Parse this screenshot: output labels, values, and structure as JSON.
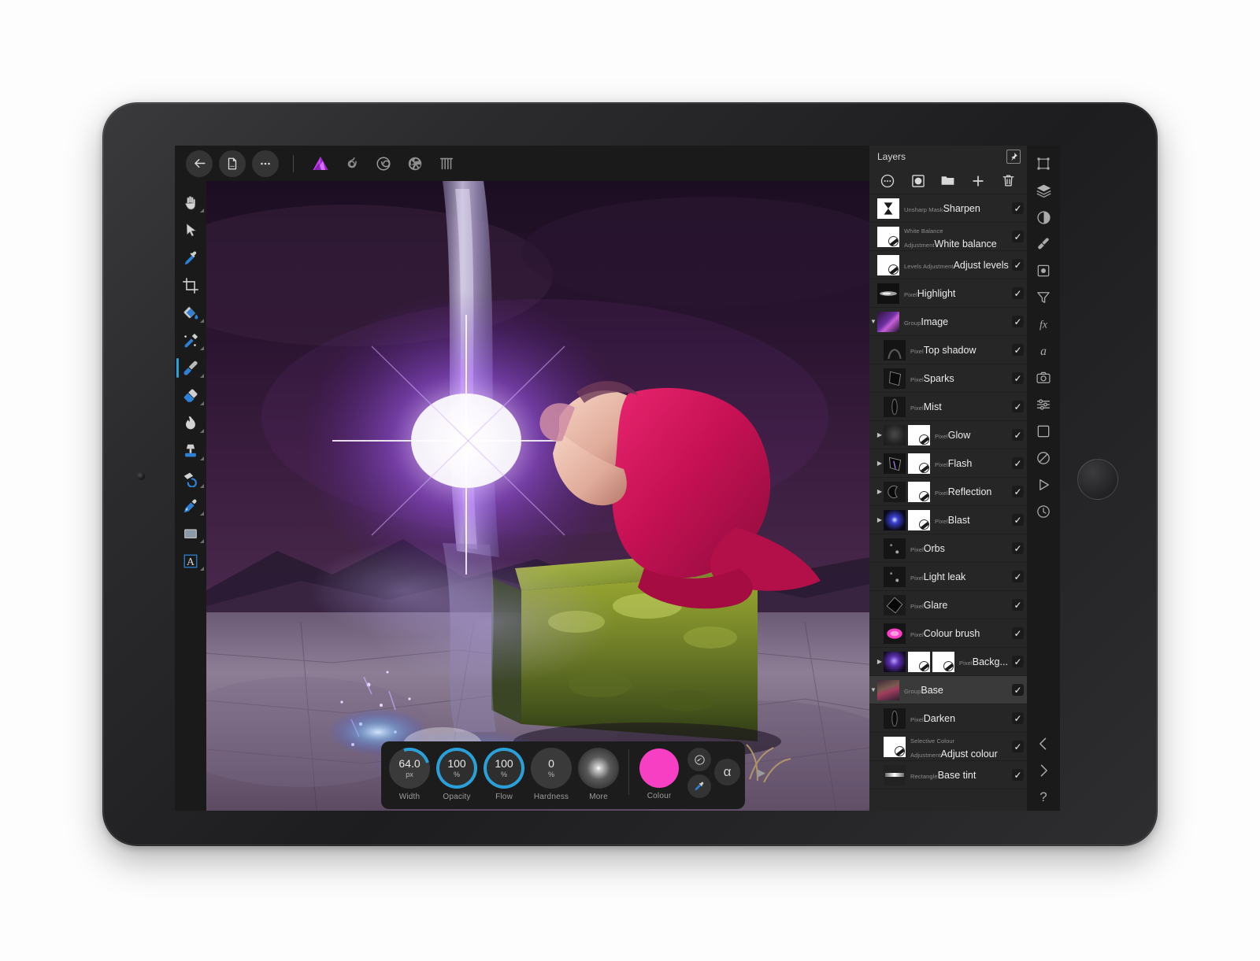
{
  "app": {
    "name": "Affinity Photo"
  },
  "topbar": {
    "buttons": [
      {
        "name": "back-button",
        "icon": "arrow-left-icon",
        "label": "Back"
      },
      {
        "name": "document-button",
        "icon": "document-icon",
        "label": "Document"
      },
      {
        "name": "more-button",
        "icon": "ellipsis-icon",
        "label": "More"
      }
    ],
    "personas": [
      {
        "name": "photo-persona",
        "icon": "affinity-photo-logo-icon",
        "label": "Photo Persona",
        "active": true,
        "color": "#c23ff0"
      },
      {
        "name": "liquify-persona",
        "icon": "liquify-icon",
        "label": "Liquify Persona",
        "active": false
      },
      {
        "name": "develop-persona",
        "icon": "develop-spiral-icon",
        "label": "Develop Persona",
        "active": false
      },
      {
        "name": "tone-mapping-persona",
        "icon": "shutter-icon",
        "label": "Tone Mapping Persona",
        "active": false
      },
      {
        "name": "export-persona",
        "icon": "export-slices-icon",
        "label": "Export Persona",
        "active": false
      }
    ]
  },
  "tools": [
    {
      "name": "hand-tool",
      "icon": "hand-icon",
      "label": "Hand",
      "selected": false,
      "submenu": true
    },
    {
      "name": "move-tool",
      "icon": "cursor-arrow-icon",
      "label": "Move",
      "selected": false,
      "submenu": false
    },
    {
      "name": "colour-picker-tool",
      "icon": "eyedropper-icon",
      "label": "Colour Picker",
      "selected": false,
      "submenu": false
    },
    {
      "name": "crop-tool",
      "icon": "crop-icon",
      "label": "Crop",
      "selected": false,
      "submenu": false
    },
    {
      "name": "flood-fill-tool",
      "icon": "paint-bucket-icon",
      "label": "Flood Fill",
      "selected": false,
      "submenu": true
    },
    {
      "name": "selection-brush-tool",
      "icon": "selection-brush-icon",
      "label": "Selection Brush",
      "selected": false,
      "submenu": true
    },
    {
      "name": "paint-brush-tool",
      "icon": "paint-brush-icon",
      "label": "Paint Brush",
      "selected": true,
      "submenu": true
    },
    {
      "name": "eraser-tool",
      "icon": "eraser-icon",
      "label": "Erase Brush",
      "selected": false,
      "submenu": true
    },
    {
      "name": "smudge-tool",
      "icon": "smudge-flame-icon",
      "label": "Smudge Brush",
      "selected": false,
      "submenu": true
    },
    {
      "name": "clone-tool",
      "icon": "clone-stamp-icon",
      "label": "Clone Brush",
      "selected": false,
      "submenu": true
    },
    {
      "name": "undo-brush-tool",
      "icon": "undo-brush-icon",
      "label": "Undo Brush",
      "selected": false,
      "submenu": true
    },
    {
      "name": "pen-tool",
      "icon": "pen-icon",
      "label": "Pen",
      "selected": false,
      "submenu": true
    },
    {
      "name": "shape-tool",
      "icon": "rectangle-shape-icon",
      "label": "Rectangle",
      "selected": false,
      "submenu": true
    },
    {
      "name": "text-tool",
      "icon": "text-a-icon",
      "label": "Artistic Text",
      "selected": false,
      "submenu": true
    }
  ],
  "brush_hud": {
    "items": [
      {
        "name": "width-dial",
        "label": "Width",
        "value": "64.0",
        "unit": "px",
        "ring": false,
        "arc": true
      },
      {
        "name": "opacity-dial",
        "label": "Opacity",
        "value": "100",
        "unit": "%",
        "ring": true,
        "arc": false
      },
      {
        "name": "flow-dial",
        "label": "Flow",
        "value": "100",
        "unit": "%",
        "ring": true,
        "arc": false
      },
      {
        "name": "hardness-dial",
        "label": "Hardness",
        "value": "0",
        "unit": "%",
        "ring": false,
        "arc": false
      },
      {
        "name": "more-dial",
        "label": "More",
        "value": "",
        "unit": "",
        "ring": false,
        "arc": false
      }
    ],
    "colour": {
      "label": "Colour",
      "hex": "#f73fc4"
    },
    "extras": [
      {
        "name": "brush-settings-button",
        "icon": "brush-edit-icon"
      },
      {
        "name": "colour-picker-button",
        "icon": "dropper-icon"
      },
      {
        "name": "alpha-button",
        "icon": "alpha-icon",
        "glyph": "α"
      }
    ],
    "expand": {
      "name": "expand-hud-button",
      "icon": "chevron-right-icon",
      "glyph": "▶"
    }
  },
  "layers_panel": {
    "title": "Layers",
    "pin": {
      "name": "pin-panel-button",
      "icon": "pin-icon"
    },
    "tools": [
      {
        "name": "layer-options-button",
        "icon": "ellipsis-circle-icon"
      },
      {
        "name": "add-mask-button",
        "icon": "mask-icon"
      },
      {
        "name": "add-group-button",
        "icon": "folder-icon"
      },
      {
        "name": "add-layer-button",
        "icon": "plus-icon"
      },
      {
        "name": "delete-layer-button",
        "icon": "trash-icon"
      }
    ],
    "rows": [
      {
        "kind": "Unsharp Mask",
        "name": "Sharpen",
        "indent": 0,
        "disclosure": "",
        "checked": true,
        "selected": false,
        "thumbs": [
          "white-hourglass"
        ]
      },
      {
        "kind": "White Balance Adjustment",
        "name": "White balance",
        "indent": 0,
        "disclosure": "",
        "checked": true,
        "selected": false,
        "thumbs": [
          "white-adj"
        ]
      },
      {
        "kind": "Levels Adjustment",
        "name": "Adjust levels",
        "indent": 0,
        "disclosure": "",
        "checked": true,
        "selected": false,
        "thumbs": [
          "white-adj"
        ]
      },
      {
        "kind": "Pixel",
        "name": "Highlight",
        "indent": 0,
        "disclosure": "",
        "checked": true,
        "selected": false,
        "thumbs": [
          "streak"
        ]
      },
      {
        "kind": "Group",
        "name": "Image",
        "indent": 0,
        "disclosure": "down",
        "checked": true,
        "selected": false,
        "thumbs": [
          "photo-blast"
        ]
      },
      {
        "kind": "Pixel",
        "name": "Top shadow",
        "indent": 1,
        "disclosure": "",
        "checked": true,
        "selected": false,
        "thumbs": [
          "dark-arch"
        ]
      },
      {
        "kind": "Pixel",
        "name": "Sparks",
        "indent": 1,
        "disclosure": "",
        "checked": true,
        "selected": false,
        "thumbs": [
          "dark-blob"
        ]
      },
      {
        "kind": "Pixel",
        "name": "Mist",
        "indent": 1,
        "disclosure": "",
        "checked": true,
        "selected": false,
        "thumbs": [
          "dark-column"
        ]
      },
      {
        "kind": "Pixel",
        "name": "Glow",
        "indent": 1,
        "disclosure": "right",
        "checked": true,
        "selected": false,
        "thumbs": [
          "faint-glow",
          "white-adj"
        ]
      },
      {
        "kind": "Pixel",
        "name": "Flash",
        "indent": 1,
        "disclosure": "right",
        "checked": true,
        "selected": false,
        "thumbs": [
          "dark-flash",
          "white-adj"
        ]
      },
      {
        "kind": "Pixel",
        "name": "Reflection",
        "indent": 1,
        "disclosure": "right",
        "checked": true,
        "selected": false,
        "thumbs": [
          "dark-crescent",
          "white-adj"
        ]
      },
      {
        "kind": "Pixel",
        "name": "Blast",
        "indent": 1,
        "disclosure": "right",
        "checked": true,
        "selected": false,
        "thumbs": [
          "blue-blast",
          "white-adj"
        ]
      },
      {
        "kind": "Pixel",
        "name": "Orbs",
        "indent": 1,
        "disclosure": "",
        "checked": true,
        "selected": false,
        "thumbs": [
          "dots"
        ]
      },
      {
        "kind": "Pixel",
        "name": "Light leak",
        "indent": 1,
        "disclosure": "",
        "checked": true,
        "selected": false,
        "thumbs": [
          "dots"
        ]
      },
      {
        "kind": "Pixel",
        "name": "Glare",
        "indent": 1,
        "disclosure": "",
        "checked": true,
        "selected": false,
        "thumbs": [
          "black-diamond"
        ]
      },
      {
        "kind": "Pixel",
        "name": "Colour brush",
        "indent": 1,
        "disclosure": "",
        "checked": true,
        "selected": false,
        "thumbs": [
          "pink-blob"
        ]
      },
      {
        "kind": "Pixel",
        "name": "Backg...",
        "indent": 1,
        "disclosure": "right",
        "checked": true,
        "selected": false,
        "thumbs": [
          "purple-photo",
          "white-adj",
          "white-adj"
        ]
      },
      {
        "kind": "Group",
        "name": "Base",
        "indent": 0,
        "disclosure": "down",
        "checked": true,
        "selected": true,
        "thumbs": [
          "photo-base"
        ]
      },
      {
        "kind": "Pixel",
        "name": "Darken",
        "indent": 1,
        "disclosure": "",
        "checked": true,
        "selected": false,
        "thumbs": [
          "dark-column"
        ]
      },
      {
        "kind": "Selective Colour Adjustment",
        "name": "Adjust colour",
        "indent": 1,
        "disclosure": "",
        "checked": true,
        "selected": false,
        "thumbs": [
          "white-adj"
        ]
      },
      {
        "kind": "Rectangle",
        "name": "Base tint",
        "indent": 1,
        "disclosure": "",
        "checked": true,
        "selected": false,
        "thumbs": [
          "gradient-bar"
        ]
      }
    ]
  },
  "right_rail": {
    "top": [
      {
        "name": "transform-panel-icon",
        "icon": "transform-icon"
      },
      {
        "name": "layers-panel-icon",
        "icon": "layers-stack-icon"
      },
      {
        "name": "adjustments-panel-icon",
        "icon": "adjustment-circle-icon"
      },
      {
        "name": "brushes-panel-icon",
        "icon": "brush-icon"
      },
      {
        "name": "effects-panel-icon",
        "icon": "effects-square-icon"
      },
      {
        "name": "filters-panel-icon",
        "icon": "funnel-icon"
      },
      {
        "name": "fx-panel-icon",
        "icon": "fx-icon"
      },
      {
        "name": "text-panel-icon",
        "icon": "italic-a-icon"
      },
      {
        "name": "camera-panel-icon",
        "icon": "camera-icon"
      },
      {
        "name": "sliders-panel-icon",
        "icon": "sliders-icon"
      },
      {
        "name": "shapes-panel-icon",
        "icon": "square-outline-icon"
      },
      {
        "name": "blend-panel-icon",
        "icon": "no-entry-icon"
      },
      {
        "name": "export-panel-icon",
        "icon": "play-triangle-icon"
      },
      {
        "name": "history-panel-icon",
        "icon": "clock-icon"
      }
    ],
    "bottom": [
      {
        "name": "undo-button",
        "icon": "chevron-left-icon"
      },
      {
        "name": "redo-button",
        "icon": "chevron-right-icon"
      },
      {
        "name": "help-button",
        "icon": "question-mark-icon",
        "glyph": "?"
      }
    ]
  }
}
